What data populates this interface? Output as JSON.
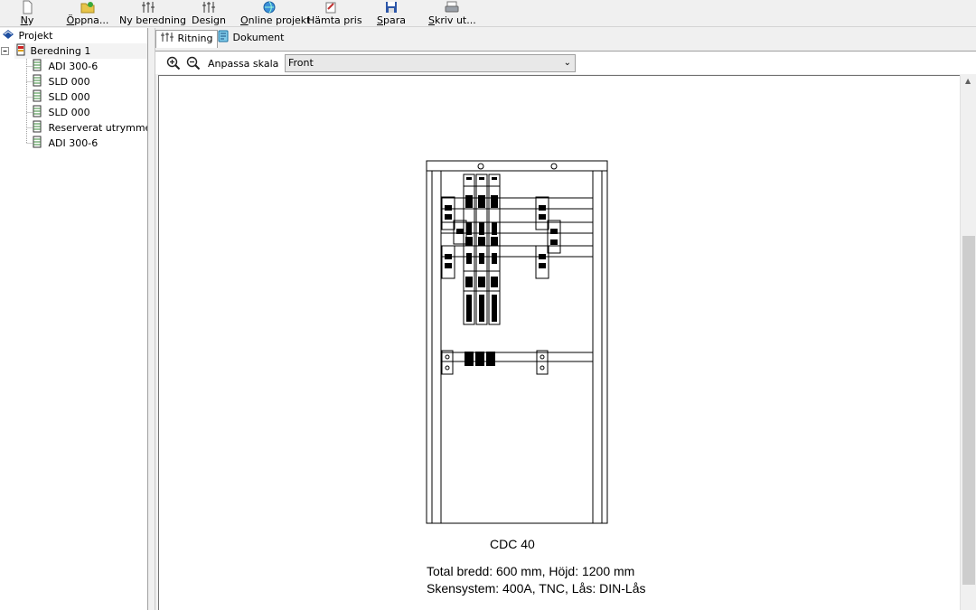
{
  "toolbar": {
    "items": [
      {
        "label_pre": "",
        "label_key": "N",
        "label_post": "y",
        "icon": "new-document-icon"
      },
      {
        "label_pre": "",
        "label_key": "Ö",
        "label_post": "ppna...",
        "icon": "open-folder-icon"
      },
      {
        "label_pre": "Ny beredning",
        "label_key": "",
        "label_post": "",
        "icon": "new-assembly-icon"
      },
      {
        "label_pre": "Design",
        "label_key": "",
        "label_post": "",
        "icon": "design-icon"
      },
      {
        "label_pre": "",
        "label_key": "O",
        "label_post": "nline projekt",
        "icon": "online-project-icon"
      },
      {
        "label_pre": "Hämta pris",
        "label_key": "",
        "label_post": "",
        "icon": "fetch-price-icon"
      },
      {
        "label_pre": "",
        "label_key": "S",
        "label_post": "para",
        "icon": "save-icon"
      },
      {
        "label_pre": "",
        "label_key": "S",
        "label_post": "kriv ut...",
        "icon": "print-icon"
      }
    ]
  },
  "tree": {
    "root": "Projekt",
    "assembly": "Beredning 1",
    "children": [
      "ADI 300-6",
      "SLD 000",
      "SLD 000",
      "SLD 000",
      "Reserverat utrymme på s",
      "ADI 300-6"
    ]
  },
  "tabs": {
    "drawing": "Ritning",
    "document": "Dokument"
  },
  "viewbar": {
    "fit_scale": "Anpassa skala",
    "view_selected": "Front"
  },
  "drawing": {
    "cabinet_name": "CDC 40",
    "info_line1": "Total bredd: 600 mm, Höjd: 1200 mm",
    "info_line2": "Skensystem: 400A, TNC, Lås: DIN-Lås"
  },
  "colors": {
    "accent_blue": "#1f4fa0",
    "toolbar_bg": "#f0f0f0"
  }
}
